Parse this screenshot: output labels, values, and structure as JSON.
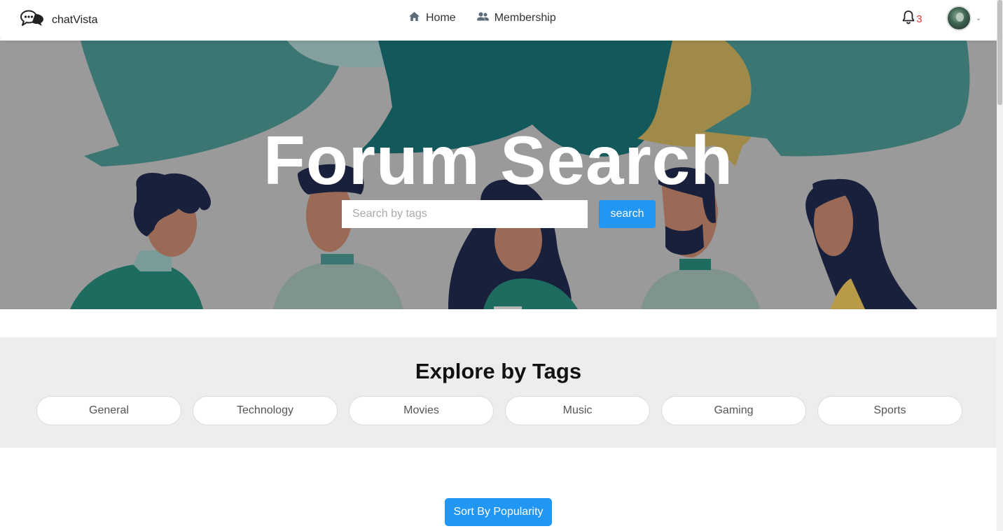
{
  "app": {
    "brand_name": "chatVista"
  },
  "nav": {
    "links": [
      {
        "label": "Home",
        "icon": "home-icon"
      },
      {
        "label": "Membership",
        "icon": "users-icon"
      }
    ],
    "notification_count": "3"
  },
  "hero": {
    "title": "Forum Search",
    "search_placeholder": "Search by tags",
    "search_button": "search"
  },
  "tags": {
    "title": "Explore by Tags",
    "items": [
      "General",
      "Technology",
      "Movies",
      "Music",
      "Gaming",
      "Sports"
    ]
  },
  "sort": {
    "label": "Sort By Popularity"
  },
  "colors": {
    "accent": "#2196f3",
    "notification": "#e53935",
    "tag_section_bg": "#ededed"
  }
}
